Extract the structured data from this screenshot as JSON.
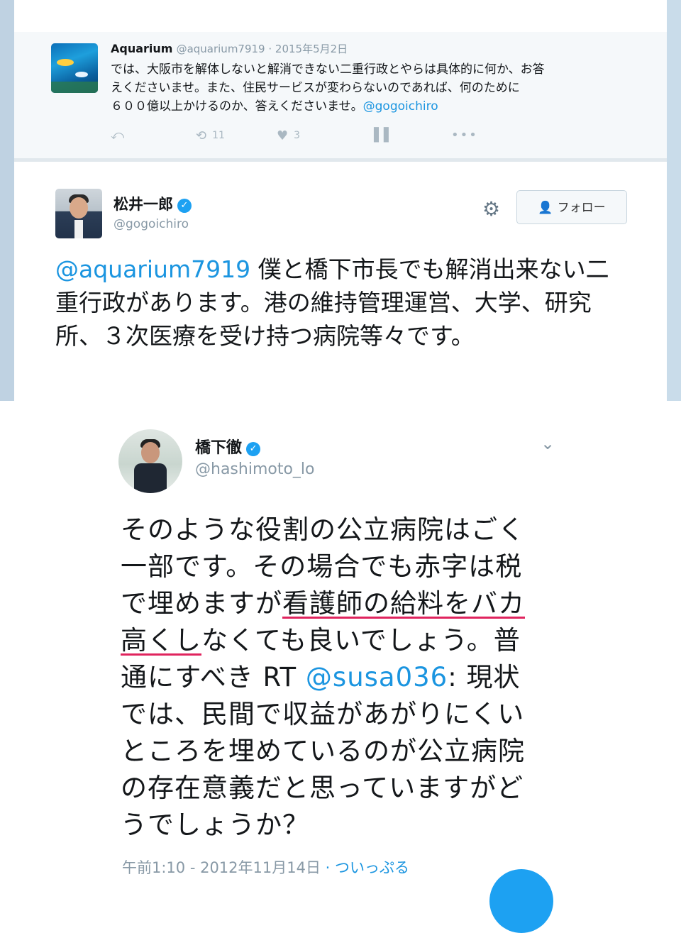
{
  "tweet1": {
    "display_name": "Aquarium",
    "handle": "@aquarium7919",
    "separator": " · ",
    "date": "2015年5月2日",
    "text_line1": "では、大阪市を解体しないと解消できない二重行政とやらは具体的に何か、お答",
    "text_line2": "えくださいませ。また、住民サービスが変わらないのであれば、何のために",
    "text_line3": "６００億以上かけるのか、答えくださいませ。",
    "mention": "@gogoichiro",
    "retweet_count": "11",
    "like_count": "3",
    "icons": [
      "reply-icon",
      "retweet-icon",
      "like-icon",
      "analytics-icon",
      "more-icon"
    ]
  },
  "tweet2": {
    "display_name": "松井一郎",
    "verified": true,
    "handle": "@gogoichiro",
    "follow_label": "フォロー",
    "mention": "@aquarium7919",
    "text": " 僕と橋下市長でも解消出来ない二重行政があります。港の維持管理運営、大学、研究所、３次医療を受け持つ病院等々です。"
  },
  "tweet3": {
    "display_name": "橋下徹",
    "verified": true,
    "handle": "@hashimoto_lo",
    "text_before": "そのような役割の公立病院はごく一部です。その場合でも赤字は税で埋めますが",
    "text_underlined": "看護師の給料をバカ高くし",
    "text_after": "なくても良いでしょう。普通にすべき RT ",
    "mention": "@susa036",
    "text_end": ": 現状では、民間で収益があがりにくいところを埋めているのが公立病院の存在意義だと思っていますがどうでしょうか？",
    "time": "午前1:10 - 2012年11月14日",
    "via": " · ついっぷる"
  },
  "colors": {
    "link": "#1b95e0",
    "verified": "#1da1f2",
    "underline": "#e0245e",
    "muted": "#8899a6"
  }
}
